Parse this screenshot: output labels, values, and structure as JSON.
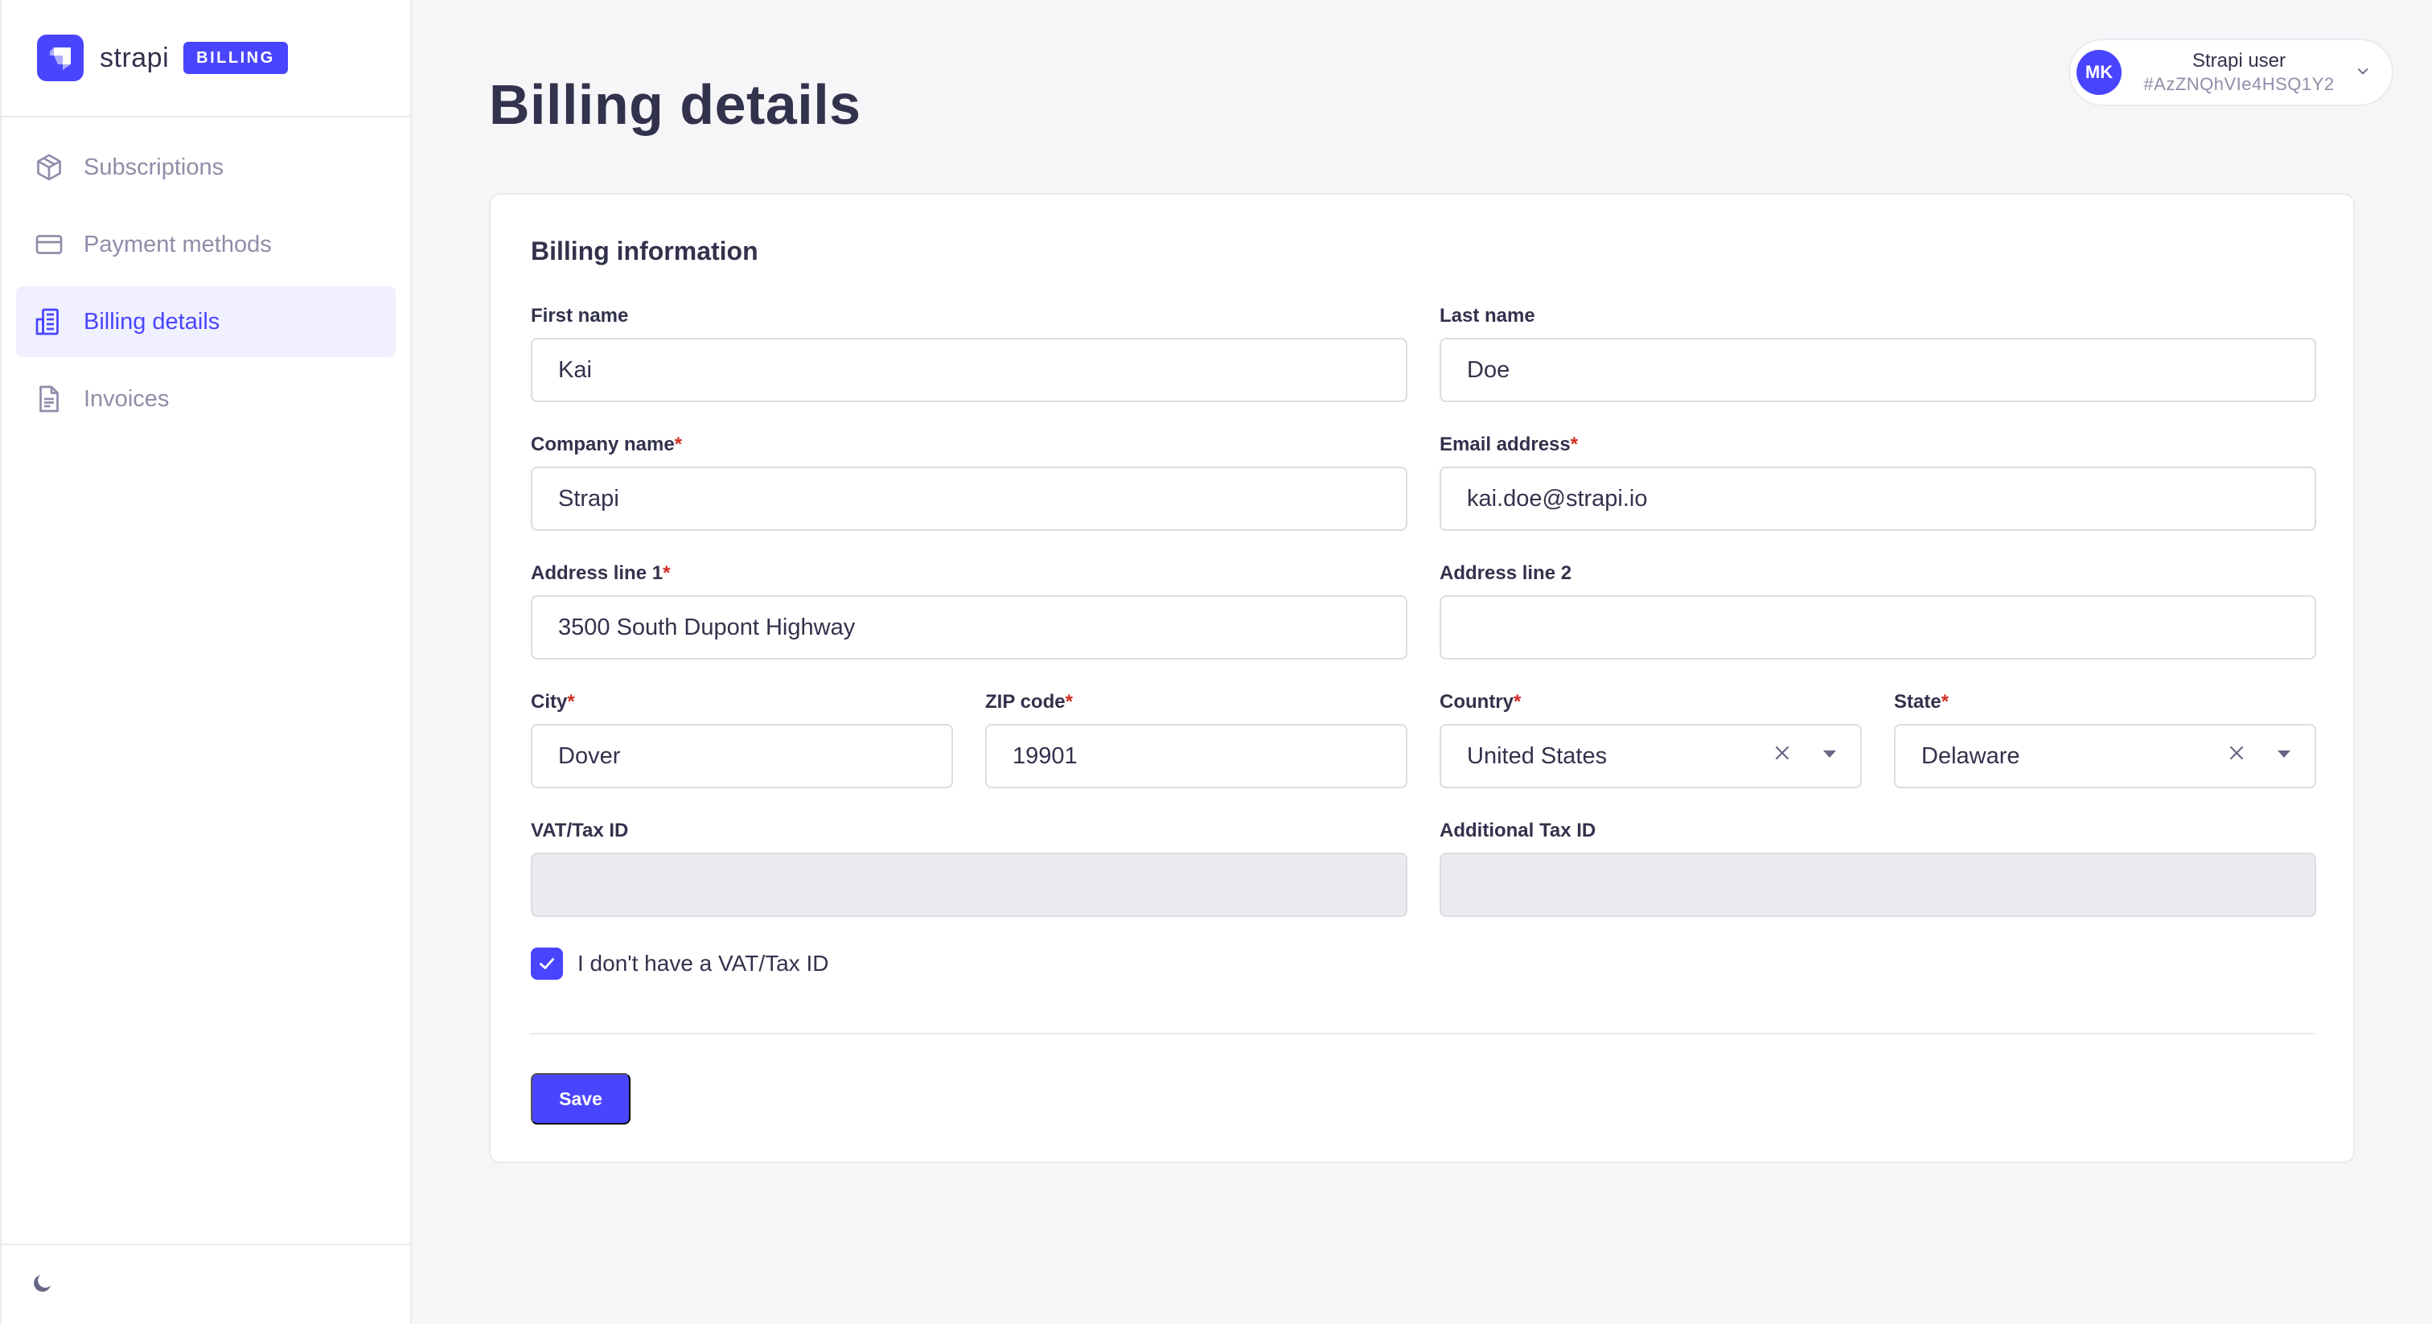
{
  "brand": {
    "name": "strapi",
    "badge": "BILLING",
    "accent": "#4945ff"
  },
  "sidebar": {
    "items": [
      {
        "label": "Subscriptions",
        "icon": "box-icon",
        "active": false
      },
      {
        "label": "Payment methods",
        "icon": "credit-card-icon",
        "active": false
      },
      {
        "label": "Billing details",
        "icon": "building-icon",
        "active": true
      },
      {
        "label": "Invoices",
        "icon": "document-icon",
        "active": false
      }
    ],
    "footer_icon": "moon-icon"
  },
  "header": {
    "title": "Billing details"
  },
  "user": {
    "initials": "MK",
    "name": "Strapi user",
    "id": "#AzZNQhVIe4HSQ1Y2"
  },
  "form": {
    "section_title": "Billing information",
    "first_name": {
      "label": "First name",
      "value": "Kai"
    },
    "last_name": {
      "label": "Last name",
      "value": "Doe"
    },
    "company_name": {
      "label": "Company name",
      "value": "Strapi",
      "required": "*"
    },
    "email": {
      "label": "Email address",
      "value": "kai.doe@strapi.io",
      "required": "*"
    },
    "address1": {
      "label": "Address line 1",
      "value": "3500 South Dupont Highway",
      "required": "*"
    },
    "address2": {
      "label": "Address line 2",
      "value": ""
    },
    "city": {
      "label": "City",
      "value": "Dover",
      "required": "*"
    },
    "zip": {
      "label": "ZIP code",
      "value": "19901",
      "required": "*"
    },
    "country": {
      "label": "Country",
      "value": "United States",
      "required": "*"
    },
    "state": {
      "label": "State",
      "value": "Delaware",
      "required": "*"
    },
    "vat": {
      "label": "VAT/Tax ID",
      "value": ""
    },
    "additional_tax": {
      "label": "Additional Tax ID",
      "value": ""
    },
    "no_vat_checkbox": {
      "label": "I don't have a VAT/Tax ID",
      "checked": true
    },
    "save_label": "Save"
  }
}
